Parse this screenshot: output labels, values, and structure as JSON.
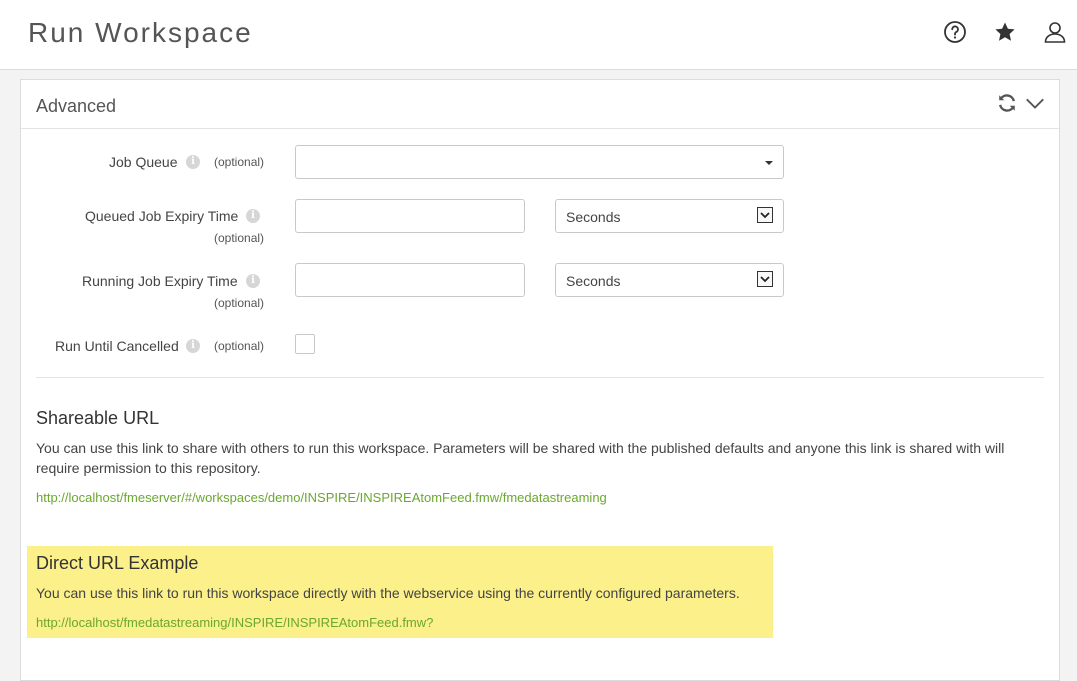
{
  "header": {
    "title": "Run Workspace",
    "icons": [
      "help-icon",
      "favorites-star-icon",
      "user-icon"
    ]
  },
  "panel": {
    "title": "Advanced",
    "icons": [
      "refresh-icon",
      "collapse-chevron-icon"
    ]
  },
  "form": {
    "job_queue": {
      "label": "Job Queue",
      "optional": "(optional)",
      "value": ""
    },
    "queued_expiry": {
      "label": "Queued Job Expiry Time",
      "optional": "(optional)",
      "value": "",
      "unit": "Seconds"
    },
    "running_expiry": {
      "label": "Running Job Expiry Time",
      "optional": "(optional)",
      "value": "",
      "unit": "Seconds"
    },
    "run_until_cancelled": {
      "label": "Run Until Cancelled",
      "optional": "(optional)",
      "checked": false
    }
  },
  "shareable": {
    "title": "Shareable URL",
    "line1": "You can use this link to share with others to run this workspace. Parameters will be shared with the published defaults and anyone this link is shared with will",
    "line2": "require permission to this repository.",
    "url": "http://localhost/fmeserver/#/workspaces/demo/INSPIRE/INSPIREAtomFeed.fmw/fmedatastreaming"
  },
  "direct": {
    "title": "Direct URL Example",
    "description": "You can use this link to run this workspace directly with the webservice using the currently configured parameters.",
    "url": "http://localhost/fmedatastreaming/INSPIRE/INSPIREAtomFeed.fmw?"
  },
  "colors": {
    "link": "#6aa82e",
    "highlight": "#fbf08a"
  }
}
